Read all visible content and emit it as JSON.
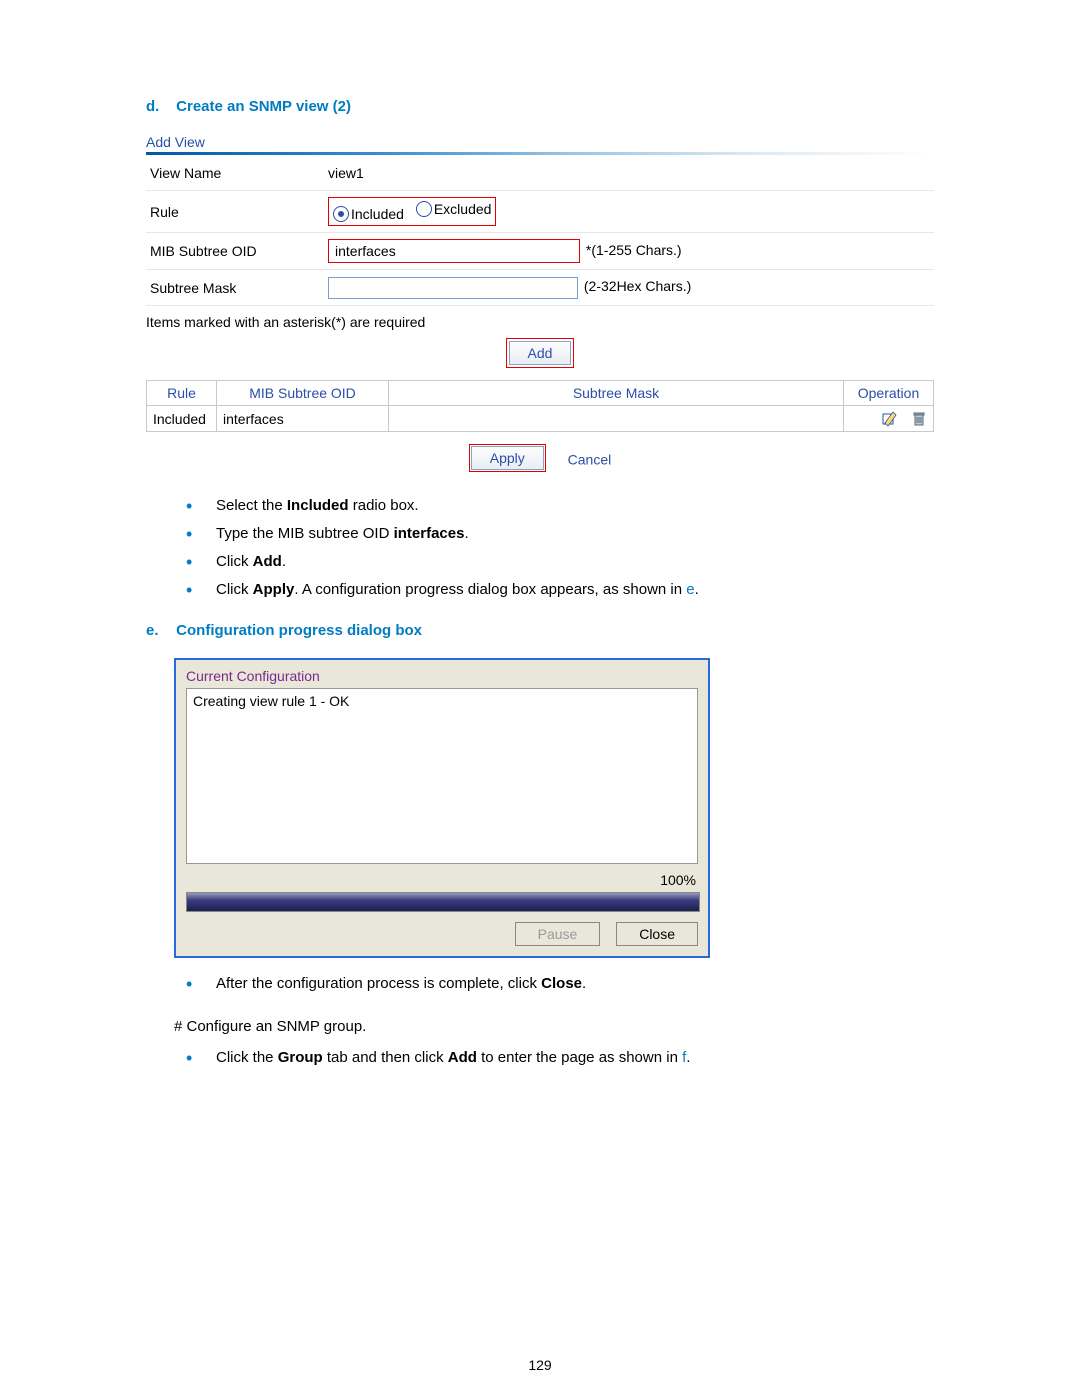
{
  "step_d": {
    "label": "d.",
    "title": "Create an SNMP view (2)"
  },
  "snmp": {
    "panel_title": "Add View",
    "fields": {
      "view_name_label": "View Name",
      "view_name_value": "view1",
      "rule_label": "Rule",
      "rule_included": "Included",
      "rule_excluded": "Excluded",
      "mib_label": "MIB Subtree OID",
      "mib_value": "interfaces",
      "mib_hint": "*(1-255 Chars.)",
      "mask_label": "Subtree Mask",
      "mask_value": "",
      "mask_hint": "(2-32Hex Chars.)"
    },
    "required_note": "Items marked with an asterisk(*) are required",
    "add_button": "Add",
    "rules_headers": {
      "rule": "Rule",
      "mib": "MIB Subtree OID",
      "mask": "Subtree Mask",
      "operation": "Operation"
    },
    "rules_row": {
      "rule": "Included",
      "mib": "interfaces",
      "mask": ""
    },
    "apply_button": "Apply",
    "cancel_button": "Cancel"
  },
  "instructions_d": {
    "i1a": "Select the ",
    "i1b": "Included",
    "i1c": " radio box.",
    "i2a": "Type the MIB subtree OID ",
    "i2b": "interfaces",
    "i2c": ".",
    "i3a": "Click ",
    "i3b": "Add",
    "i3c": ".",
    "i4a": "Click ",
    "i4b": "Apply",
    "i4c": ". A configuration progress dialog box appears, as shown in ",
    "i4ref": "e",
    "i4d": "."
  },
  "step_e": {
    "label": "e.",
    "title": "Configuration progress dialog box"
  },
  "progress": {
    "title": "Current Configuration",
    "log": "Creating view rule 1 - OK",
    "percent": "100%",
    "pause": "Pause",
    "close": "Close"
  },
  "instructions_e": {
    "i1a": "After the configuration process is complete, click ",
    "i1b": "Close",
    "i1c": "."
  },
  "group_note": "# Configure an SNMP group.",
  "instructions_f": {
    "i1a": "Click the ",
    "i1b": "Group",
    "i1c": " tab and then click ",
    "i1d": "Add",
    "i1e": " to enter the page as shown in ",
    "i1ref": "f",
    "i1f": "."
  },
  "page_number": "129"
}
